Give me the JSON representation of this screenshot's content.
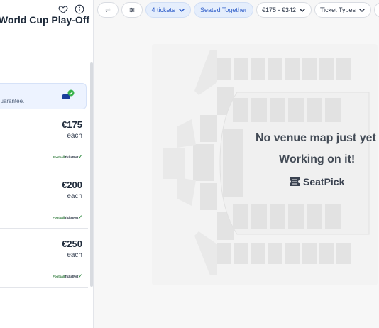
{
  "event": {
    "title": "World Cup Play-Off"
  },
  "header_icons": [
    "heart-icon",
    "info-icon"
  ],
  "guarantee": {
    "text": "guarantee."
  },
  "listings": [
    {
      "price": "€175",
      "unit": "each",
      "seller_a": "Football",
      "seller_b": "TicketNet"
    },
    {
      "price": "€200",
      "unit": "each",
      "seller_a": "Football",
      "seller_b": "TicketNet"
    },
    {
      "price": "€250",
      "unit": "each",
      "seller_a": "Football",
      "seller_b": "TicketNet"
    }
  ],
  "toolbar": {
    "tickets": "4 tickets",
    "seated": "Seated Together",
    "price_range": "€175 - €342",
    "ticket_types": "Ticket Types",
    "icons": [
      "swap-icon",
      "sliders-icon",
      "chevron-down-icon"
    ]
  },
  "map": {
    "line1": "No venue map just yet",
    "line2": "Working on it!",
    "brand": "SeatPick"
  },
  "colors": {
    "accent": "#2f5ec9",
    "active_chip": "#e5eefc",
    "seller_green": "#2f7a3b"
  }
}
